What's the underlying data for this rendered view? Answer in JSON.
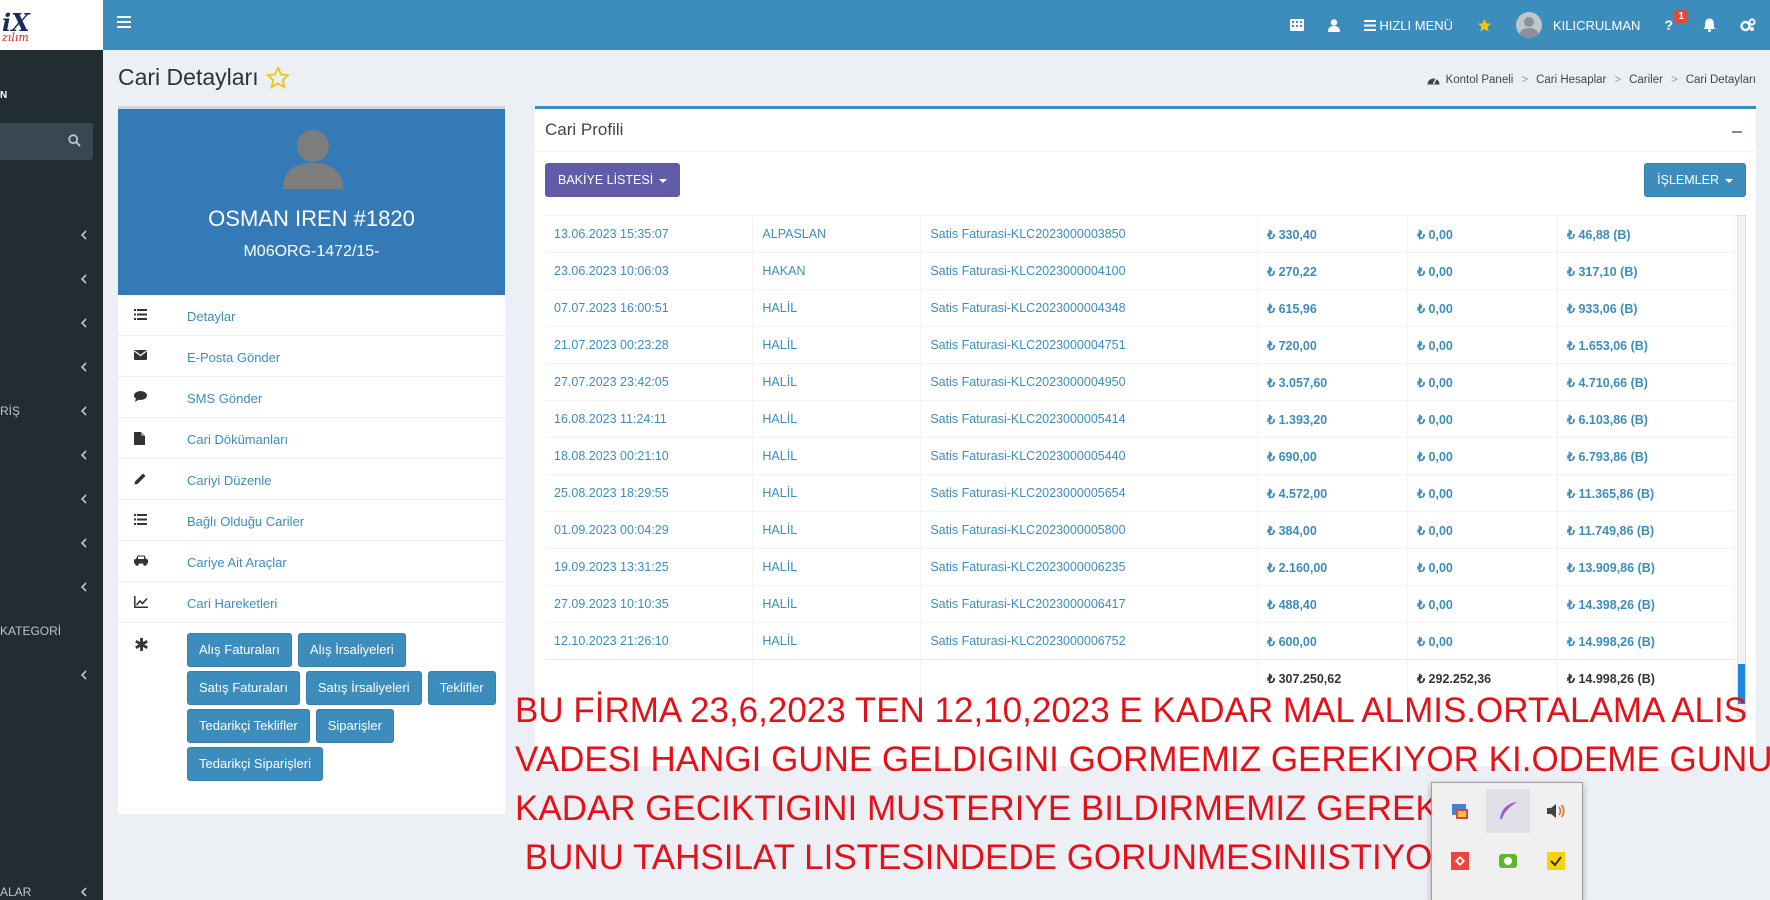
{
  "app": {
    "logo_text": "iX",
    "logo_sub": "zılım"
  },
  "topbar": {
    "quick_menu_label": "HIZLI MENÜ",
    "user_name": "KILICRULMAN",
    "help_badge": "1"
  },
  "sidebar": {
    "user_text": "N",
    "items": [
      {
        "label": ""
      },
      {
        "label": ""
      },
      {
        "label": ""
      },
      {
        "label": ""
      },
      {
        "label": "RİŞ"
      },
      {
        "label": ""
      },
      {
        "label": ""
      },
      {
        "label": ""
      },
      {
        "label": ""
      },
      {
        "label": "KATEGORİ"
      },
      {
        "label": ""
      },
      {
        "label": "ALAR"
      }
    ]
  },
  "page": {
    "title": "Cari Detayları"
  },
  "breadcrumb": {
    "items": [
      "Kontol Paneli",
      "Cari Hesaplar",
      "Cariler",
      "Cari Detayları"
    ]
  },
  "profile": {
    "name": "OSMAN IREN #1820",
    "code": "M06ORG-1472/15-",
    "menu": [
      {
        "label": "Detaylar",
        "icon": "list-icon"
      },
      {
        "label": "E-Posta Gönder",
        "icon": "envelope-icon"
      },
      {
        "label": "SMS Gönder",
        "icon": "comment-icon"
      },
      {
        "label": "Cari Dökümanları",
        "icon": "file-icon"
      },
      {
        "label": "Cariyi Düzenle",
        "icon": "pencil-icon"
      },
      {
        "label": "Bağlı Olduğu Cariler",
        "icon": "list-icon"
      },
      {
        "label": "Cariye Ait Araçlar",
        "icon": "car-icon"
      },
      {
        "label": "Cari Hareketleri",
        "icon": "line-chart-icon"
      }
    ],
    "buttons": [
      "Alış Faturaları",
      "Alış İrsaliyeleri",
      "Satış Faturaları",
      "Satış İrsaliyeleri",
      "Teklifler",
      "Tedarikçi Teklifler",
      "Siparişler",
      "Tedarikçi Siparişleri"
    ]
  },
  "main": {
    "box_title": "Cari Profili",
    "balance_button": "BAKİYE LİSTESİ",
    "actions_button": "İŞLEMLER",
    "rows": [
      {
        "date": "13.06.2023 15:35:07",
        "user": "ALPASLAN",
        "desc": "Satis Faturasi-KLC2023000003850",
        "debit": "₺ 330,40",
        "credit": "₺ 0,00",
        "balance": "₺ 46,88 (B)"
      },
      {
        "date": "23.06.2023 10:06:03",
        "user": "HAKAN",
        "desc": "Satis Faturasi-KLC2023000004100",
        "debit": "₺ 270,22",
        "credit": "₺ 0,00",
        "balance": "₺ 317,10 (B)"
      },
      {
        "date": "07.07.2023 16:00:51",
        "user": "HALİL",
        "desc": "Satis Faturasi-KLC2023000004348",
        "debit": "₺ 615,96",
        "credit": "₺ 0,00",
        "balance": "₺ 933,06 (B)"
      },
      {
        "date": "21.07.2023 00:23:28",
        "user": "HALİL",
        "desc": "Satis Faturasi-KLC2023000004751",
        "debit": "₺ 720,00",
        "credit": "₺ 0,00",
        "balance": "₺ 1.653,06 (B)"
      },
      {
        "date": "27.07.2023 23:42:05",
        "user": "HALİL",
        "desc": "Satis Faturasi-KLC2023000004950",
        "debit": "₺ 3.057,60",
        "credit": "₺ 0,00",
        "balance": "₺ 4.710,66 (B)"
      },
      {
        "date": "16.08.2023 11:24:11",
        "user": "HALİL",
        "desc": "Satis Faturasi-KLC2023000005414",
        "debit": "₺ 1.393,20",
        "credit": "₺ 0,00",
        "balance": "₺ 6.103,86 (B)"
      },
      {
        "date": "18.08.2023 00:21:10",
        "user": "HALİL",
        "desc": "Satis Faturasi-KLC2023000005440",
        "debit": "₺ 690,00",
        "credit": "₺ 0,00",
        "balance": "₺ 6.793,86 (B)"
      },
      {
        "date": "25.08.2023 18:29:55",
        "user": "HALİL",
        "desc": "Satis Faturasi-KLC2023000005654",
        "debit": "₺ 4.572,00",
        "credit": "₺ 0,00",
        "balance": "₺ 11.365,86 (B)"
      },
      {
        "date": "01.09.2023 00:04:29",
        "user": "HALİL",
        "desc": "Satis Faturasi-KLC2023000005800",
        "debit": "₺ 384,00",
        "credit": "₺ 0,00",
        "balance": "₺ 11.749,86 (B)"
      },
      {
        "date": "19.09.2023 13:31:25",
        "user": "HALİL",
        "desc": "Satis Faturasi-KLC2023000006235",
        "debit": "₺ 2.160,00",
        "credit": "₺ 0,00",
        "balance": "₺ 13.909,86 (B)"
      },
      {
        "date": "27.09.2023 10:10:35",
        "user": "HALİL",
        "desc": "Satis Faturasi-KLC2023000006417",
        "debit": "₺ 488,40",
        "credit": "₺ 0,00",
        "balance": "₺ 14.398,26 (B)"
      },
      {
        "date": "12.10.2023 21:26:10",
        "user": "HALİL",
        "desc": "Satis Faturasi-KLC2023000006752",
        "debit": "₺ 600,00",
        "credit": "₺ 0,00",
        "balance": "₺ 14.998,26 (B)"
      }
    ],
    "totals": {
      "debit": "₺ 307.250,62",
      "credit": "₺ 292.252,36",
      "balance": "₺ 14.998,26 (B)"
    }
  },
  "annotation": {
    "lines": [
      "BU FİRMA 23,6,2023 TEN 12,10,2023 E KADAR MAL ALMIS.ORTALAMA ALIS",
      "VADESI HANGI GUNE GELDIGINI GORMEMIZ GEREKIYOR KI.ODEME GUNU NE",
      "KADAR GECIKTIGINI MUSTERIYE BILDIRMEMIZ GEREKIYOR",
      " BUNU TAHSILAT LISTESINDEDE GORUNMESINIISTIYORUZ"
    ]
  },
  "colors": {
    "topbar": "#3c8dbc",
    "sidebar": "#222d32",
    "profile_header": "#337ab7",
    "purple_button": "#605ca8",
    "annotation": "#e3121a"
  }
}
